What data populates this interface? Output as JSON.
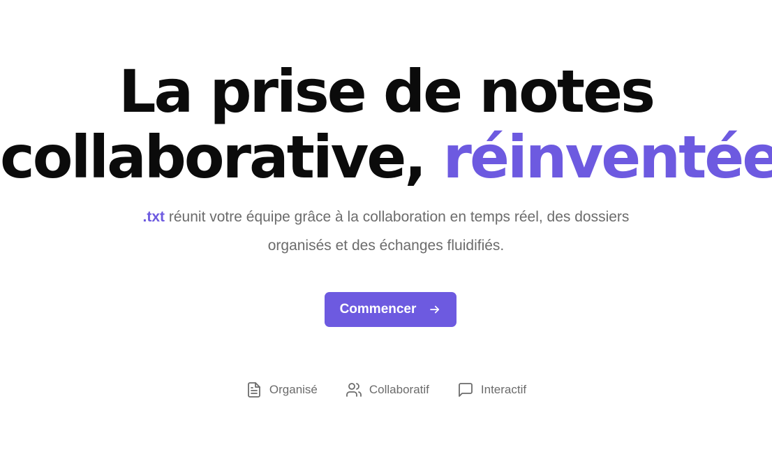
{
  "hero": {
    "headline_line1": "La prise de notes",
    "headline_line2_prefix": "collaborative, ",
    "headline_accent": "réinventée",
    "lede_brand": ".txt",
    "lede_text": " réunit votre équipe grâce à la collaboration en temps réel, des dossiers organisés et des échanges fluidifiés.",
    "cta_label": "Commencer",
    "cta_icon": "arrow-right-icon"
  },
  "features": [
    {
      "label": "Organisé",
      "icon": "document-icon"
    },
    {
      "label": "Collaboratif",
      "icon": "users-icon"
    },
    {
      "label": "Interactif",
      "icon": "message-square-icon"
    }
  ],
  "colors": {
    "accent": "#6d5ae0",
    "text": "#0b0b0b",
    "muted": "#6b6b6b",
    "background": "#ffffff"
  }
}
